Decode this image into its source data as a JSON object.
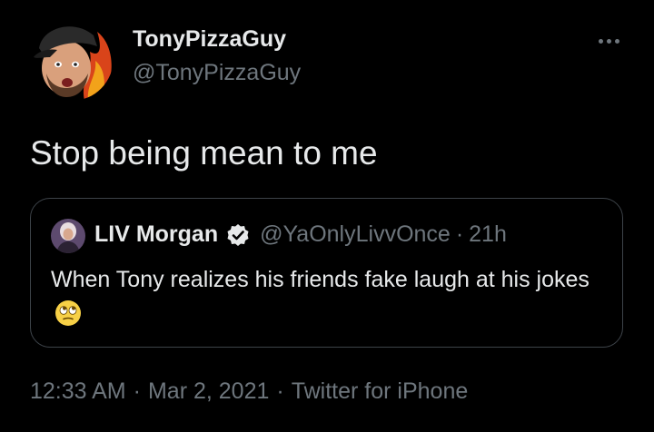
{
  "author": {
    "display_name": "TonyPizzaGuy",
    "handle": "@TonyPizzaGuy"
  },
  "tweet": {
    "text": "Stop being mean to me"
  },
  "quoted_tweet": {
    "display_name": "LIV Morgan",
    "handle": "@YaOnlyLivvOnce",
    "separator": "·",
    "time": "21h",
    "text": "When Tony realizes his friends fake laugh at his jokes",
    "emoji": "face-with-rolling-eyes",
    "verified": true
  },
  "meta": {
    "time": "12:33 AM",
    "date": "Mar 2, 2021",
    "source": "Twitter for iPhone",
    "separator": "·"
  },
  "colors": {
    "background": "#000000",
    "primary_text": "#e7e9ea",
    "secondary_text": "#6e767d",
    "card_border": "#3d4349"
  },
  "icons": {
    "more": "more-horizontal-icon",
    "verified": "verified-badge-icon"
  }
}
